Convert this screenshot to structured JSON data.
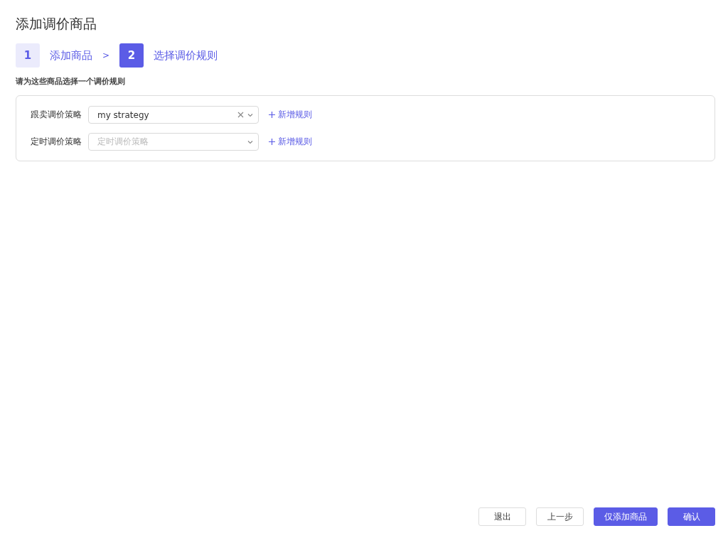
{
  "title": "添加调价商品",
  "steps": [
    {
      "number": "1",
      "label": "添加商品",
      "selected": false
    },
    {
      "number": "2",
      "label": "选择调价规则",
      "selected": true
    }
  ],
  "step_separator": ">",
  "instruction": "请为这些商品选择一个调价规则",
  "form": {
    "rows": [
      {
        "label": "跟卖调价策略",
        "value": "my strategy",
        "clearable": true,
        "add_link": "新增规则"
      },
      {
        "label": "定时调价策略",
        "placeholder": "定时调价策略",
        "clearable": false,
        "add_link": "新增规则"
      }
    ]
  },
  "buttons": [
    {
      "label": "退出",
      "kind": "default"
    },
    {
      "label": "上一步",
      "kind": "default"
    },
    {
      "label": "仅添加商品",
      "kind": "primary"
    },
    {
      "label": "确认",
      "kind": "primary"
    }
  ]
}
